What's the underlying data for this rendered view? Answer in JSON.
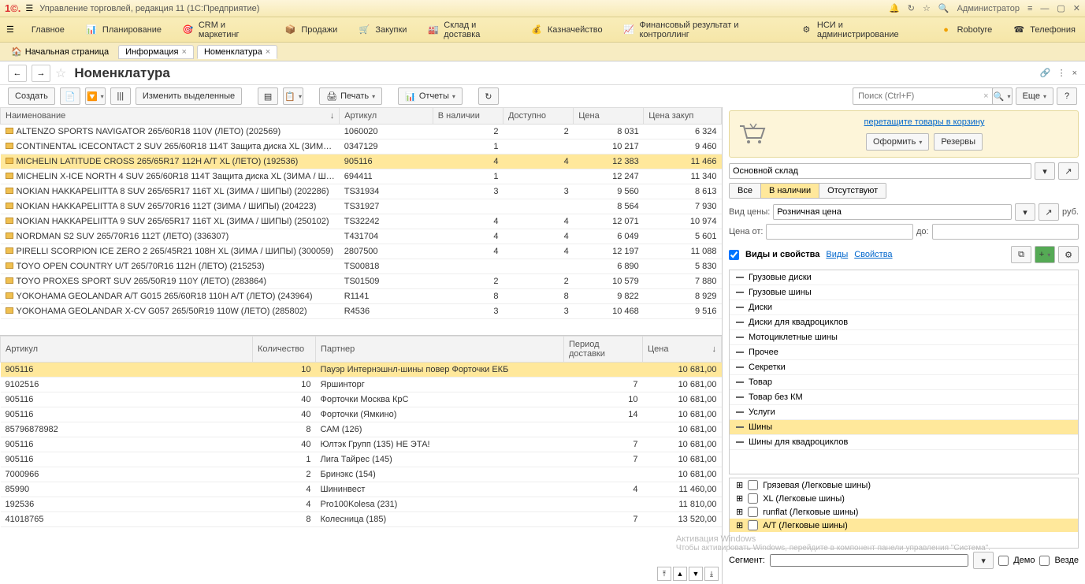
{
  "titlebar": {
    "title": "Управление торговлей, редакция 11  (1С:Предприятие)",
    "admin": "Администратор"
  },
  "mainmenu": [
    {
      "label": "Главное"
    },
    {
      "label": "Планирование"
    },
    {
      "label": "CRM и маркетинг"
    },
    {
      "label": "Продажи"
    },
    {
      "label": "Закупки"
    },
    {
      "label": "Склад и доставка"
    },
    {
      "label": "Казначейство"
    },
    {
      "label": "Финансовый результат и контроллинг"
    },
    {
      "label": "НСИ и администрирование"
    },
    {
      "label": "Robotyre"
    },
    {
      "label": "Телефония"
    }
  ],
  "tabs": {
    "home": "Начальная страница",
    "t1": "Информация",
    "t2": "Номенклатура"
  },
  "page_title": "Номенклатура",
  "toolbar": {
    "create": "Создать",
    "edit_selected": "Изменить выделенные",
    "print": "Печать",
    "reports": "Отчеты",
    "search_placeholder": "Поиск (Ctrl+F)",
    "more": "Еще"
  },
  "table1": {
    "headers": {
      "name": "Наименование",
      "sku": "Артикул",
      "stock": "В наличии",
      "avail": "Доступно",
      "price": "Цена",
      "cost": "Цена закуп"
    },
    "rows": [
      {
        "name": "ALTENZO SPORTS NAVIGATOR 265/60R18 110V (ЛЕТО) (202569)",
        "sku": "1060020",
        "stock": "2",
        "avail": "2",
        "price": "8 031",
        "cost": "6 324"
      },
      {
        "name": "CONTINENTAL ICECONTACT 2 SUV 265/60R18 114T Защита диска XL (ЗИМ…",
        "sku": "0347129",
        "stock": "1",
        "avail": "",
        "price": "10 217",
        "cost": "9 460"
      },
      {
        "name": "MICHELIN LATITUDE CROSS 265/65R17 112H A/T XL (ЛЕТО) (192536)",
        "sku": "905116",
        "stock": "4",
        "avail": "4",
        "price": "12 383",
        "cost": "11 466",
        "selected": true
      },
      {
        "name": "MICHELIN X-ICE NORTH 4 SUV 265/60R18 114T Защита диска XL (ЗИМА / Ш…",
        "sku": "694411",
        "stock": "1",
        "avail": "",
        "price": "12 247",
        "cost": "11 340"
      },
      {
        "name": "NOKIAN HAKKAPELIITTA 8 SUV 265/65R17 116T XL (ЗИМА / ШИПЫ) (202286)",
        "sku": "TS31934",
        "stock": "3",
        "avail": "3",
        "price": "9 560",
        "cost": "8 613"
      },
      {
        "name": "NOKIAN HAKKAPELIITTA 8 SUV 265/70R16 112T (ЗИМА / ШИПЫ) (204223)",
        "sku": "TS31927",
        "stock": "",
        "avail": "",
        "price": "8 564",
        "cost": "7 930"
      },
      {
        "name": "NOKIAN HAKKAPELIITTA 9 SUV 265/65R17 116T XL (ЗИМА / ШИПЫ) (250102)",
        "sku": "TS32242",
        "stock": "4",
        "avail": "4",
        "price": "12 071",
        "cost": "10 974"
      },
      {
        "name": "NORDMAN S2 SUV 265/70R16 112T (ЛЕТО) (336307)",
        "sku": "T431704",
        "stock": "4",
        "avail": "4",
        "price": "6 049",
        "cost": "5 601"
      },
      {
        "name": "PIRELLI SCORPION ICE ZERO 2 265/45R21 108H XL (ЗИМА / ШИПЫ) (300059)",
        "sku": "2807500",
        "stock": "4",
        "avail": "4",
        "price": "12 197",
        "cost": "11 088"
      },
      {
        "name": "TOYO OPEN COUNTRY U/T 265/70R16 112H (ЛЕТО) (215253)",
        "sku": "TS00818",
        "stock": "",
        "avail": "",
        "price": "6 890",
        "cost": "5 830"
      },
      {
        "name": "TOYO PROXES SPORT SUV 265/50R19 110Y (ЛЕТО) (283864)",
        "sku": "TS01509",
        "stock": "2",
        "avail": "2",
        "price": "10 579",
        "cost": "7 880"
      },
      {
        "name": "YOKOHAMA GEOLANDAR A/T G015 265/60R18 110H A/T (ЛЕТО) (243964)",
        "sku": "R1141",
        "stock": "8",
        "avail": "8",
        "price": "9 822",
        "cost": "8 929"
      },
      {
        "name": "YOKOHAMA GEOLANDAR X-CV G057 265/50R19 110W (ЛЕТО) (285802)",
        "sku": "R4536",
        "stock": "3",
        "avail": "3",
        "price": "10 468",
        "cost": "9 516"
      }
    ]
  },
  "table2": {
    "headers": {
      "sku": "Артикул",
      "qty": "Количество",
      "partner": "Партнер",
      "delivery": "Период доставки",
      "price": "Цена"
    },
    "rows": [
      {
        "sku": "905116",
        "qty": "10",
        "partner": "Пауэр Интернэшнл-шины повер Форточки ЕКБ",
        "delivery": "",
        "price": "10 681,00",
        "selected": true
      },
      {
        "sku": "9102516",
        "qty": "10",
        "partner": "Яршинторг",
        "delivery": "7",
        "price": "10 681,00"
      },
      {
        "sku": "905116",
        "qty": "40",
        "partner": "Форточки Москва КрС",
        "delivery": "10",
        "price": "10 681,00"
      },
      {
        "sku": "905116",
        "qty": "40",
        "partner": "Форточки (Ямкино)",
        "delivery": "14",
        "price": "10 681,00"
      },
      {
        "sku": "85796878982",
        "qty": "8",
        "partner": "САМ (126)",
        "delivery": "",
        "price": "10 681,00"
      },
      {
        "sku": "905116",
        "qty": "40",
        "partner": "Юлтэк Групп (135) НЕ ЭТА!",
        "delivery": "7",
        "price": "10 681,00"
      },
      {
        "sku": "905116",
        "qty": "1",
        "partner": "Лига Тайрес (145)",
        "delivery": "7",
        "price": "10 681,00"
      },
      {
        "sku": "7000966",
        "qty": "2",
        "partner": "Бринэкс (154)",
        "delivery": "",
        "price": "10 681,00"
      },
      {
        "sku": "85990",
        "qty": "4",
        "partner": "Шининвест",
        "delivery": "4",
        "price": "11 460,00"
      },
      {
        "sku": "192536",
        "qty": "4",
        "partner": "Pro100Kolesa (231)",
        "delivery": "",
        "price": "11 810,00"
      },
      {
        "sku": "41018765",
        "qty": "8",
        "partner": "Колесница (185)",
        "delivery": "7",
        "price": "13 520,00"
      }
    ]
  },
  "right": {
    "cart_link": "перетащите товары в корзину",
    "oform": "Оформить",
    "reserves": "Резервы",
    "warehouse": "Основной склад",
    "stock_filters": {
      "all": "Все",
      "instock": "В наличии",
      "none": "Отсутствуют"
    },
    "price_type_label": "Вид цены:",
    "price_type": "Розничная цена",
    "currency": "руб.",
    "price_from": "Цена от:",
    "price_to": "до:",
    "props_label": "Виды и свойства",
    "link_types": "Виды",
    "link_props": "Свойства",
    "categories": [
      "Грузовые диски",
      "Грузовые шины",
      "Диски",
      "Диски для квадроциклов",
      "Мотоциклетные шины",
      "Прочее",
      "Секретки",
      "Товар",
      "Товар без КМ",
      "Услуги",
      "Шины",
      "Шины для квадроциклов"
    ],
    "selected_category": "Шины",
    "filters": [
      {
        "label": "Грязевая (Легковые шины)"
      },
      {
        "label": "XL (Легковые шины)"
      },
      {
        "label": "runflat (Легковые шины)"
      },
      {
        "label": "A/T (Легковые шины)",
        "selected": true
      }
    ],
    "segment_label": "Сегмент:",
    "demo": "Демо",
    "everywhere": "Везде"
  },
  "watermark": {
    "title": "Активация Windows",
    "sub": "Чтобы активировать Windows, перейдите в компонент панели управления \"Система\"."
  }
}
